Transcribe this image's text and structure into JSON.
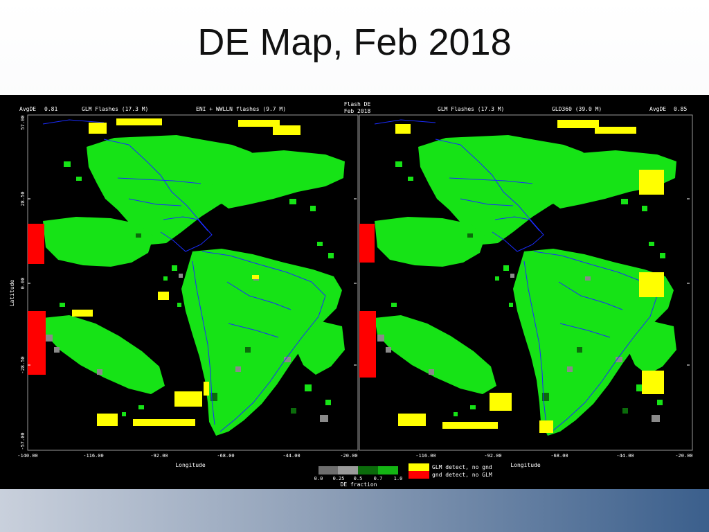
{
  "slide": {
    "title": "DE Map, Feb 2018"
  },
  "figure": {
    "center_title": [
      "Flash DE",
      "Feb 2018"
    ],
    "left_panel": {
      "avgde_label": "AvgDE",
      "avgde_value": "0.81",
      "left_source": "GLM Flashes (17.3 M)",
      "right_source": "ENI + WWLLN flashes (9.7 M)"
    },
    "right_panel": {
      "avgde_label": "AvgDE",
      "avgde_value": "0.85",
      "left_source": "GLM Flashes (17.3 M)",
      "right_source": "GLD360 (39.0 M)"
    },
    "y_axis": {
      "label": "Latitude",
      "ticks": [
        "57.00",
        "28.50",
        "0.00",
        "-28.50",
        "-57.00"
      ]
    },
    "x_axis_left": {
      "label": "Longitude",
      "ticks": [
        "-140.00",
        "-116.00",
        "-92.00",
        "-68.00",
        "-44.00",
        "-20.00"
      ]
    },
    "x_axis_right": {
      "label": "Longitude",
      "ticks": [
        "-116.00",
        "-92.00",
        "-68.00",
        "-44.00",
        "-20.00"
      ]
    },
    "colorbar": {
      "title": "DE fraction",
      "ticks": [
        "0.0",
        "0.25",
        "0.5",
        "0.7",
        "1.0"
      ],
      "colors": [
        "#6e6e6e",
        "#9a9a9a",
        "#0b6b0b",
        "#14b414",
        "#1ee61e"
      ]
    },
    "legend": [
      {
        "label": "GLM detect, no gnd",
        "color": "#ffff00",
        "text_color": "#ffff00"
      },
      {
        "label": "gnd detect, no GLM",
        "color": "#ff0000",
        "text_color": "#ff2020"
      }
    ]
  }
}
